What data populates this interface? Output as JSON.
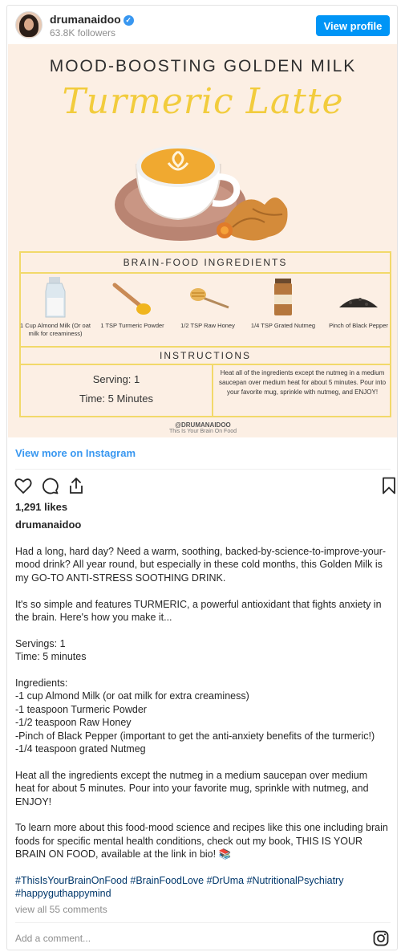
{
  "header": {
    "username": "drumanaidoo",
    "followers": "63.8K followers",
    "view_profile_label": "View profile"
  },
  "post_image": {
    "title": "MOOD-BOOSTING GOLDEN MILK",
    "script_title": "Turmeric Latte",
    "ingredients_title": "BRAIN-FOOD INGREDIENTS",
    "ingredients": [
      {
        "label": "1 Cup Almond Milk (Or oat milk for creaminess)"
      },
      {
        "label": "1 TSP Turmeric Powder"
      },
      {
        "label": "1/2 TSP Raw Honey"
      },
      {
        "label": "1/4 TSP Grated Nutmeg"
      },
      {
        "label": "Pinch of Black Pepper"
      }
    ],
    "instructions_title": "INSTRUCTIONS",
    "serving": "Serving: 1",
    "time": "Time: 5 Minutes",
    "instructions_text": "Heat all of the ingredients except the nutmeg in a medium saucepan over medium heat for about 5 minutes. Pour into your favorite mug, sprinkle with nutmeg, and ENJOY!",
    "handle": "@DRUMANAIDOO",
    "handle_sub": "This Is Your Brain On Food"
  },
  "view_more_label": "View more on Instagram",
  "likes": "1,291 likes",
  "caption_username": "drumanaidoo",
  "caption": {
    "p1": "Had a long, hard day? Need a warm, soothing, backed-by-science-to-improve-your-mood drink? All year round, but especially in these cold months, this Golden Milk is my GO-TO ANTI-STRESS SOOTHING DRINK.",
    "p2": "It's so simple and features TURMERIC, a powerful antioxidant that fights anxiety in the brain. Here's how you make it...",
    "servings": "Servings: 1",
    "time": "Time: 5 minutes",
    "ingredients_heading": "Ingredients:",
    "ing1": "-1 cup Almond Milk (or oat milk for extra creaminess)",
    "ing2": "-1 teaspoon Turmeric Powder",
    "ing3": "-1/2 teaspoon Raw Honey",
    "ing4": "-Pinch of Black Pepper (important to get the anti-anxiety benefits of the turmeric!)",
    "ing5": "-1/4 teaspoon grated Nutmeg",
    "p_heat": "Heat all the ingredients except the nutmeg in a medium saucepan over medium heat for about 5 minutes. Pour into your favorite mug, sprinkle with nutmeg, and ENJOY!",
    "p_book": "To learn more about this food-mood science and recipes like this one including brain foods for specific mental health conditions, check out my book, THIS IS YOUR BRAIN ON FOOD, available at the link in bio! 📚",
    "hashtags_line1": "#ThisIsYourBrainOnFood #BrainFoodLove #DrUma #NutritionalPsychiatry",
    "hashtags_line2": "#happyguthappymind"
  },
  "view_comments": "view all 55 comments",
  "add_comment_placeholder": "Add a comment...",
  "colors": {
    "accent_blue": "#0095f6",
    "link_blue": "#3897f0",
    "image_bg": "#fcefe4",
    "gold": "#f2cc3d"
  },
  "icons": [
    "verified-badge-icon",
    "heart-icon",
    "comment-icon",
    "share-icon",
    "bookmark-icon",
    "instagram-icon"
  ]
}
